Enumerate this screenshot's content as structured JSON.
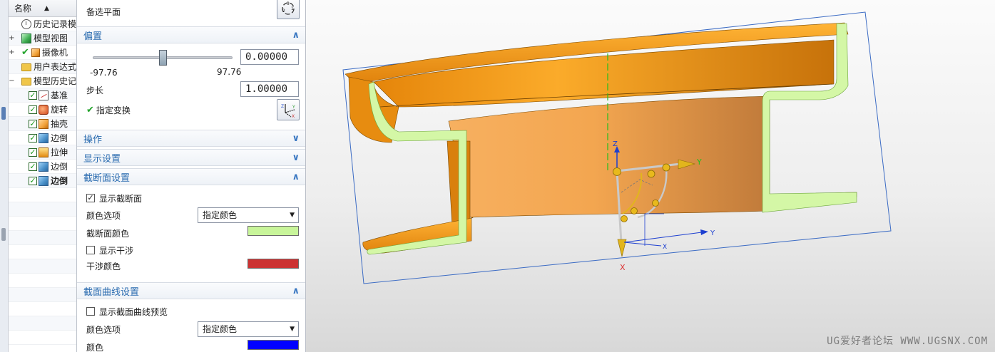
{
  "navigator": {
    "column_header": "名称",
    "items": [
      {
        "label": "历史记录模",
        "icon": "clock-icon"
      },
      {
        "label": "模型视图",
        "icon": "model-views-icon"
      },
      {
        "label": "摄像机",
        "icon": "camera-icon"
      },
      {
        "label": "用户表达式",
        "icon": "folder-icon"
      },
      {
        "label": "模型历史记",
        "icon": "folder-icon"
      },
      {
        "label": "基准",
        "icon": "datum-icon"
      },
      {
        "label": "旋转",
        "icon": "revolve-icon"
      },
      {
        "label": "抽壳",
        "icon": "shell-icon"
      },
      {
        "label": "边倒",
        "icon": "edge-blend-icon"
      },
      {
        "label": "拉伸",
        "icon": "extrude-icon"
      },
      {
        "label": "边倒",
        "icon": "edge-blend-icon"
      },
      {
        "label": "边倒",
        "icon": "edge-blend-icon"
      }
    ]
  },
  "panel": {
    "alt_plane_label": "备选平面",
    "offset": {
      "title": "偏置",
      "value": "0.00000",
      "min_label": "-97.76",
      "max_label": "97.76",
      "slider_position_fraction": 0.5,
      "step_label": "步长",
      "step_value": "1.00000",
      "specify_transform_label": "指定变换"
    },
    "operations_title": "操作",
    "display_settings_title": "显示设置",
    "section_settings": {
      "title": "截断面设置",
      "show_section_label": "显示截断面",
      "show_section_checked": true,
      "color_option_label": "颜色选项",
      "color_option_value": "指定颜色",
      "section_color_label": "截断面颜色",
      "section_color": "#c8f59a",
      "show_interference_label": "显示干涉",
      "show_interference_checked": false,
      "interference_color_label": "干涉颜色",
      "interference_color": "#cc3333"
    },
    "curve_settings": {
      "title": "截面曲线设置",
      "show_preview_label": "显示截面曲线预览",
      "show_preview_checked": false,
      "color_option_label": "颜色选项",
      "color_option_value": "指定颜色",
      "color_label": "颜色",
      "color": "#0000ff"
    }
  },
  "viewport": {
    "triad_labels": {
      "z": "Z",
      "y": "Y",
      "x": "X"
    },
    "watermark": "UG爱好者论坛 WWW.UGSNX.COM",
    "body_color": "#f59a12",
    "section_face_color": "#d4f7a6"
  }
}
